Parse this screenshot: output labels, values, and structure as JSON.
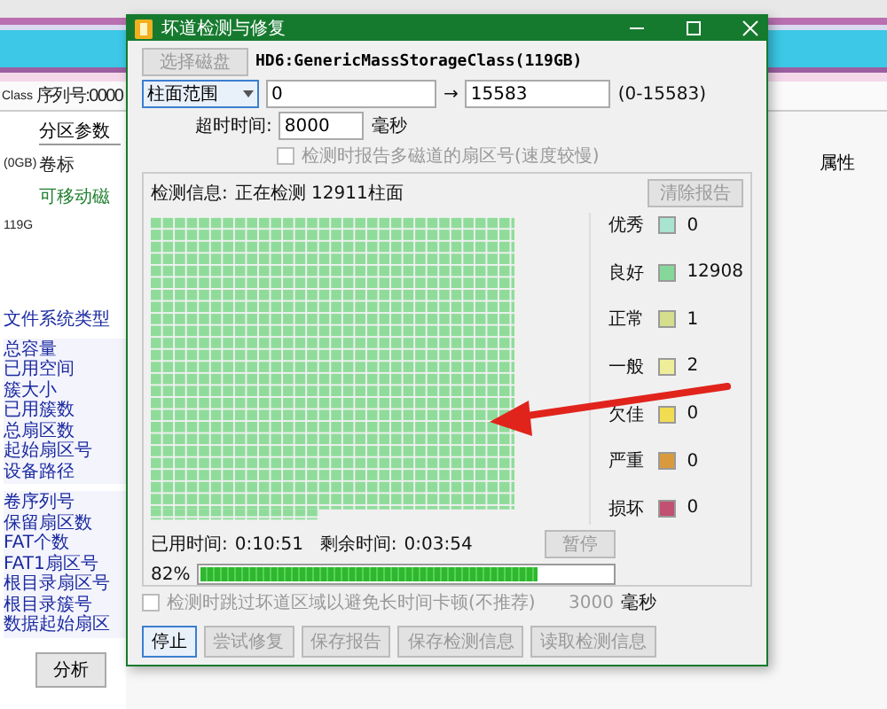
{
  "background_app": {
    "left_edge_labels": [
      "Class",
      "(0GB)",
      "119G"
    ],
    "serial_label": "序列号:0000",
    "partition_tab": "分区参数",
    "volume_header": "卷标",
    "tree_item": "可移动磁",
    "properties_header": "属性",
    "fs_header": "文件系统类型",
    "fields_group_1": [
      "总容量",
      "已用空间",
      "簇大小",
      "已用簇数",
      "总扇区数",
      "起始扇区号",
      "设备路径"
    ],
    "fields_group_2": [
      "卷序列号",
      "保留扇区数",
      "FAT个数",
      "FAT1扇区号",
      "根目录扇区号",
      "根目录簇号",
      "数据起始扇区"
    ],
    "analyze_button": "分析"
  },
  "dialog": {
    "title": "坏道检测与修复",
    "select_disk_button": {
      "label": "选择磁盘",
      "disabled": true
    },
    "disk_name": "HD6:GenericMassStorageClass(119GB)",
    "range_mode": "柱面范围",
    "range_from": "0",
    "range_arrow": "→",
    "range_to": "15583",
    "range_hint": "(0-15583)",
    "timeout_label": "超时时间:",
    "timeout_value": "8000",
    "timeout_unit": "毫秒",
    "report_option": {
      "label": "检测时报告多磁道的扇区号(速度较慢)",
      "checked": false,
      "disabled": true
    },
    "info_label": "检测信息:",
    "info_status": "正在检测  12911柱面",
    "clear_button": {
      "label": "清除报告",
      "disabled": true
    },
    "legend": [
      {
        "label": "优秀",
        "color": "#a8e4cf",
        "count": "0"
      },
      {
        "label": "良好",
        "color": "#86d89a",
        "count": "12908"
      },
      {
        "label": "正常",
        "color": "#d4de8c",
        "count": "1"
      },
      {
        "label": "一般",
        "color": "#eeee9a",
        "count": "2"
      },
      {
        "label": "欠佳",
        "color": "#f2dc52",
        "count": "0"
      },
      {
        "label": "严重",
        "color": "#d99a3e",
        "count": "0"
      },
      {
        "label": "损坏",
        "color": "#c25072",
        "count": "0"
      }
    ],
    "elapsed_label": "已用时间:",
    "elapsed": "0:10:51",
    "remaining_label": "剩余时间:",
    "remaining": "0:03:54",
    "pause_button": {
      "label": "暂停",
      "disabled": true
    },
    "percent": "82%",
    "level": 0.82,
    "skip_option": {
      "label": "检测时跳过坏道区域以避免长时间卡顿(不推荐)",
      "checked": false,
      "disabled": true
    },
    "skip_value": "3000",
    "skip_unit": "毫秒",
    "buttons": [
      {
        "label": "停止",
        "disabled": false
      },
      {
        "label": "尝试修复",
        "disabled": true
      },
      {
        "label": "保存报告",
        "disabled": true
      },
      {
        "label": "保存检测信息",
        "disabled": true
      },
      {
        "label": "读取检测信息",
        "disabled": true
      }
    ]
  }
}
